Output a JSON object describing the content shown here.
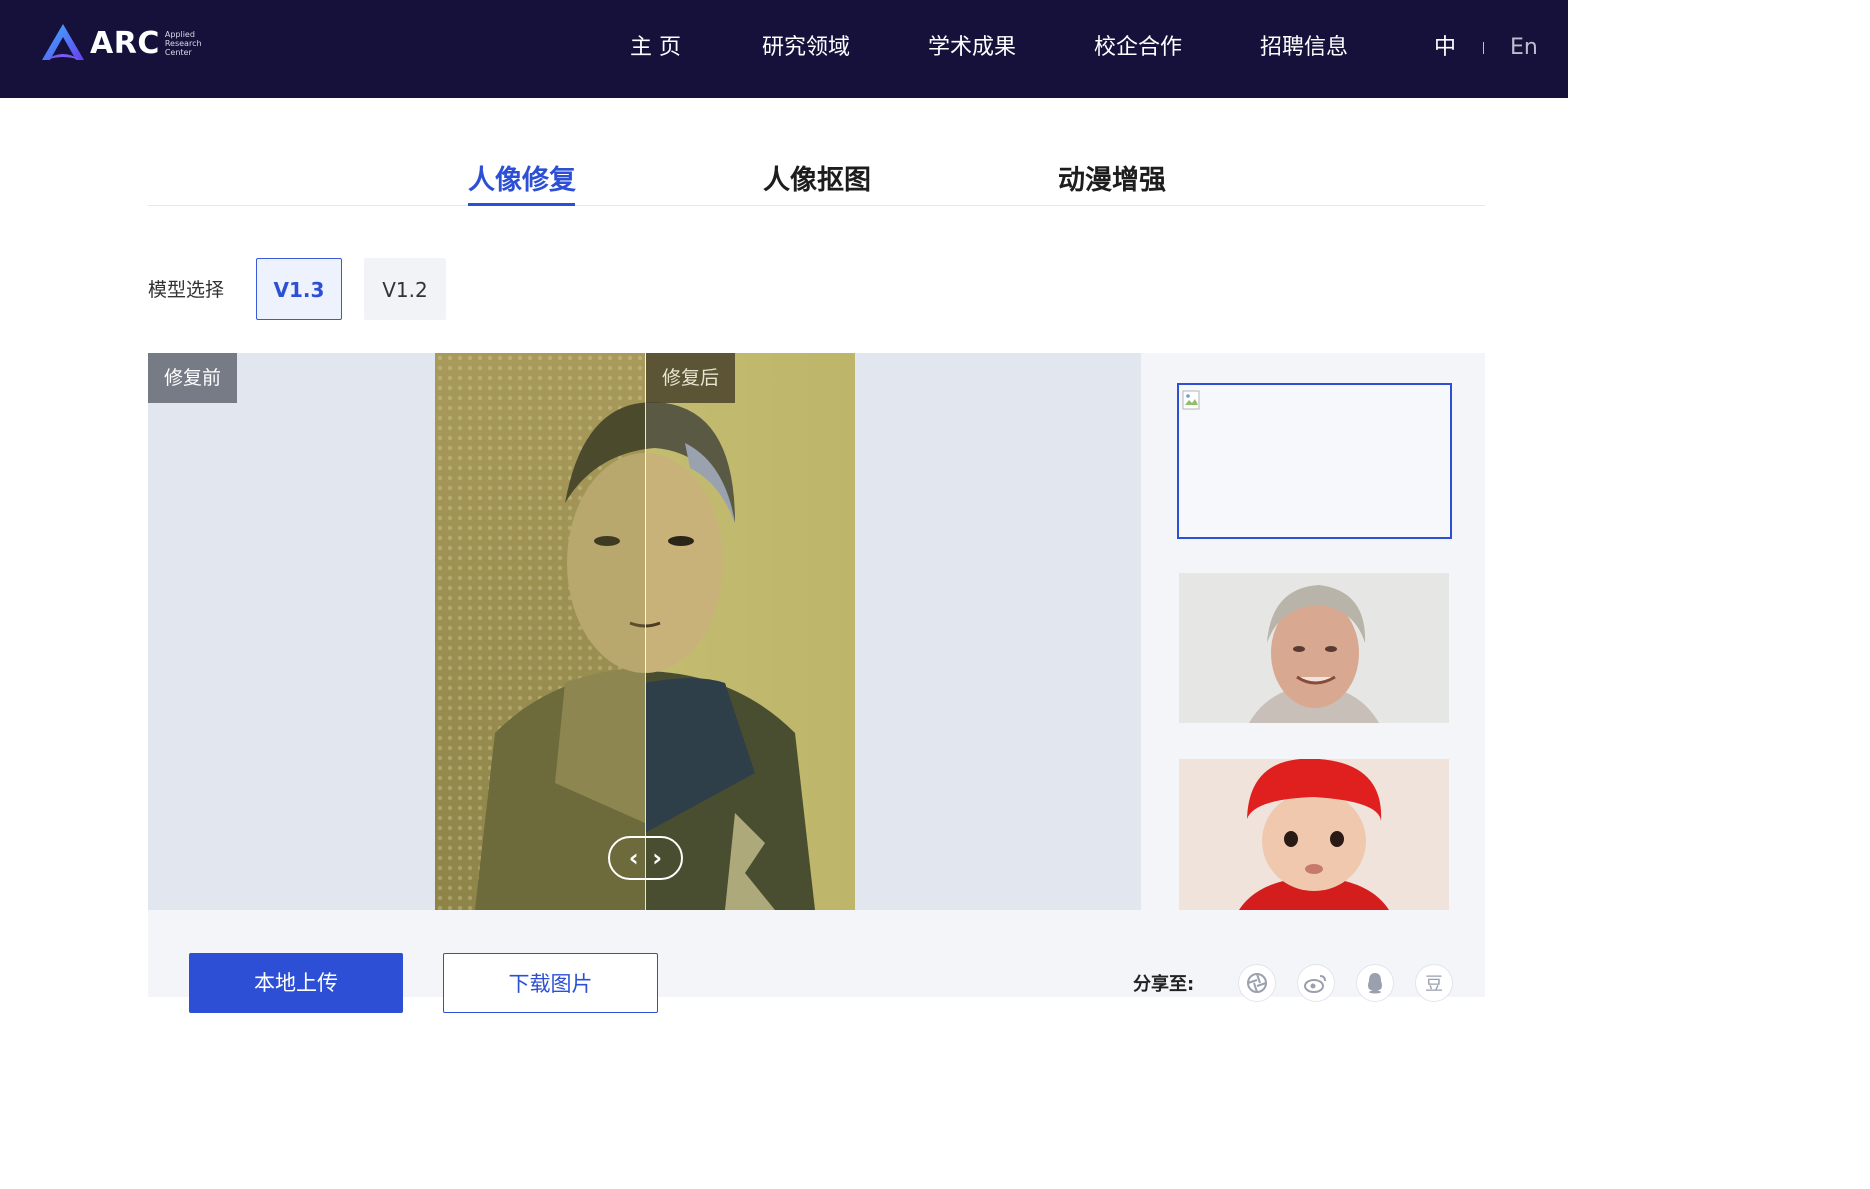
{
  "brand": {
    "logo_text": "ARC",
    "logo_sub_line1": "Applied",
    "logo_sub_line2": "Research",
    "logo_sub_line3": "Center",
    "color_header": "#15113a",
    "color_accent": "#2c4fd6"
  },
  "nav": {
    "items": [
      "主 页",
      "研究领域",
      "学术成果",
      "校企合作",
      "招聘信息"
    ],
    "lang_zh": "中",
    "lang_en": "En"
  },
  "tabs": {
    "items": [
      "人像修复",
      "人像抠图",
      "动漫增强"
    ],
    "active_index": 0
  },
  "model_select": {
    "label": "模型选择",
    "options": [
      "V1.3",
      "V1.2"
    ],
    "selected": "V1.3"
  },
  "compare": {
    "before_label": "修复前",
    "after_label": "修复后",
    "handle_left": "‹",
    "handle_right": "›"
  },
  "thumbnails": {
    "selected_index": 0,
    "items": [
      "broken-image",
      "elderly-man-portrait",
      "baby-red-hat-portrait"
    ]
  },
  "actions": {
    "upload_label": "本地上传",
    "download_label": "下载图片"
  },
  "share": {
    "label": "分享至:",
    "icons": [
      "wechat-moments-icon",
      "weibo-icon",
      "qq-icon",
      "douban-icon"
    ],
    "douban_glyph": "豆"
  }
}
